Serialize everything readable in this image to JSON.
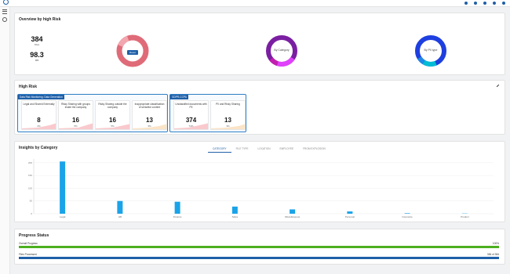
{
  "topbar": {
    "brand": "",
    "user_text": "",
    "action_icons": [
      "bell-icon",
      "help-icon",
      "settings-icon",
      "user-icon",
      "apps-icon"
    ]
  },
  "sidebar": {
    "icons": [
      "menu-icon",
      "gear-icon"
    ]
  },
  "overview": {
    "title": "Overview by high Risk",
    "stats": [
      {
        "value": "384",
        "label": "Files"
      },
      {
        "value": "98.3",
        "label": "MB"
      }
    ],
    "donuts": [
      {
        "center_label": "",
        "button": "Reset",
        "colors": [
          "#e06b78",
          "#f2a6ae"
        ]
      },
      {
        "center_label": "By Category",
        "colors": [
          "#7b1fa2",
          "#c21fb0",
          "#e040fb",
          "#9c27b0"
        ]
      },
      {
        "center_label": "By PII type",
        "colors": [
          "#1e3fe0",
          "#1e88e5",
          "#00bcd4",
          "#3949ab"
        ]
      }
    ]
  },
  "high_risk": {
    "title": "High Risk",
    "groups": [
      {
        "title": "Data Risk Monitoring: Data Generation",
        "cards": [
          {
            "label": "Legal and Shared Externally",
            "value": "8",
            "pct": "2%"
          },
          {
            "label": "Risky Sharing with groups inside the company",
            "value": "16",
            "pct": "5%"
          },
          {
            "label": "Risky Sharing outside the company",
            "value": "16",
            "pct": "5%"
          },
          {
            "label": "Inappropriate classification of sensitive content",
            "value": "13",
            "pct": "3%"
          }
        ]
      },
      {
        "title": "GDPR-CCPA",
        "cards": [
          {
            "label": "Unclassified documents with PII",
            "value": "374",
            "pct": "74%"
          },
          {
            "label": "PII and Risky Sharing",
            "value": "13",
            "pct": "3%"
          }
        ]
      }
    ]
  },
  "insights": {
    "title": "Insights by Category",
    "tabs": [
      "CATEGORY",
      "FILE TYPE",
      "LOCATION",
      "EMPLOYEE",
      "FROM EXPLOSION"
    ],
    "active_tab": 0
  },
  "chart_data": {
    "type": "bar",
    "categories": [
      "Legal",
      "HR",
      "Finance",
      "Sales",
      "Miscellaneous",
      "Personal",
      "Insurance",
      "Product"
    ],
    "values": [
      205,
      50,
      47,
      28,
      17,
      9,
      2,
      1
    ],
    "ylim": [
      0,
      215
    ],
    "yticks": [
      0,
      50,
      100,
      150,
      200
    ],
    "ytick_labels": [
      "0",
      "50",
      "100",
      "150",
      "200"
    ],
    "grid": true,
    "color": "#1aa3e8"
  },
  "progress": {
    "title": "Progress Status",
    "rows": [
      {
        "label": "Overall Progress",
        "value": "100%",
        "fraction": 1.0,
        "color": "#4caf1e"
      },
      {
        "label": "Files Processed",
        "value": "384 of 384",
        "fraction": 1.0,
        "color": "#1f5fa8"
      }
    ]
  }
}
